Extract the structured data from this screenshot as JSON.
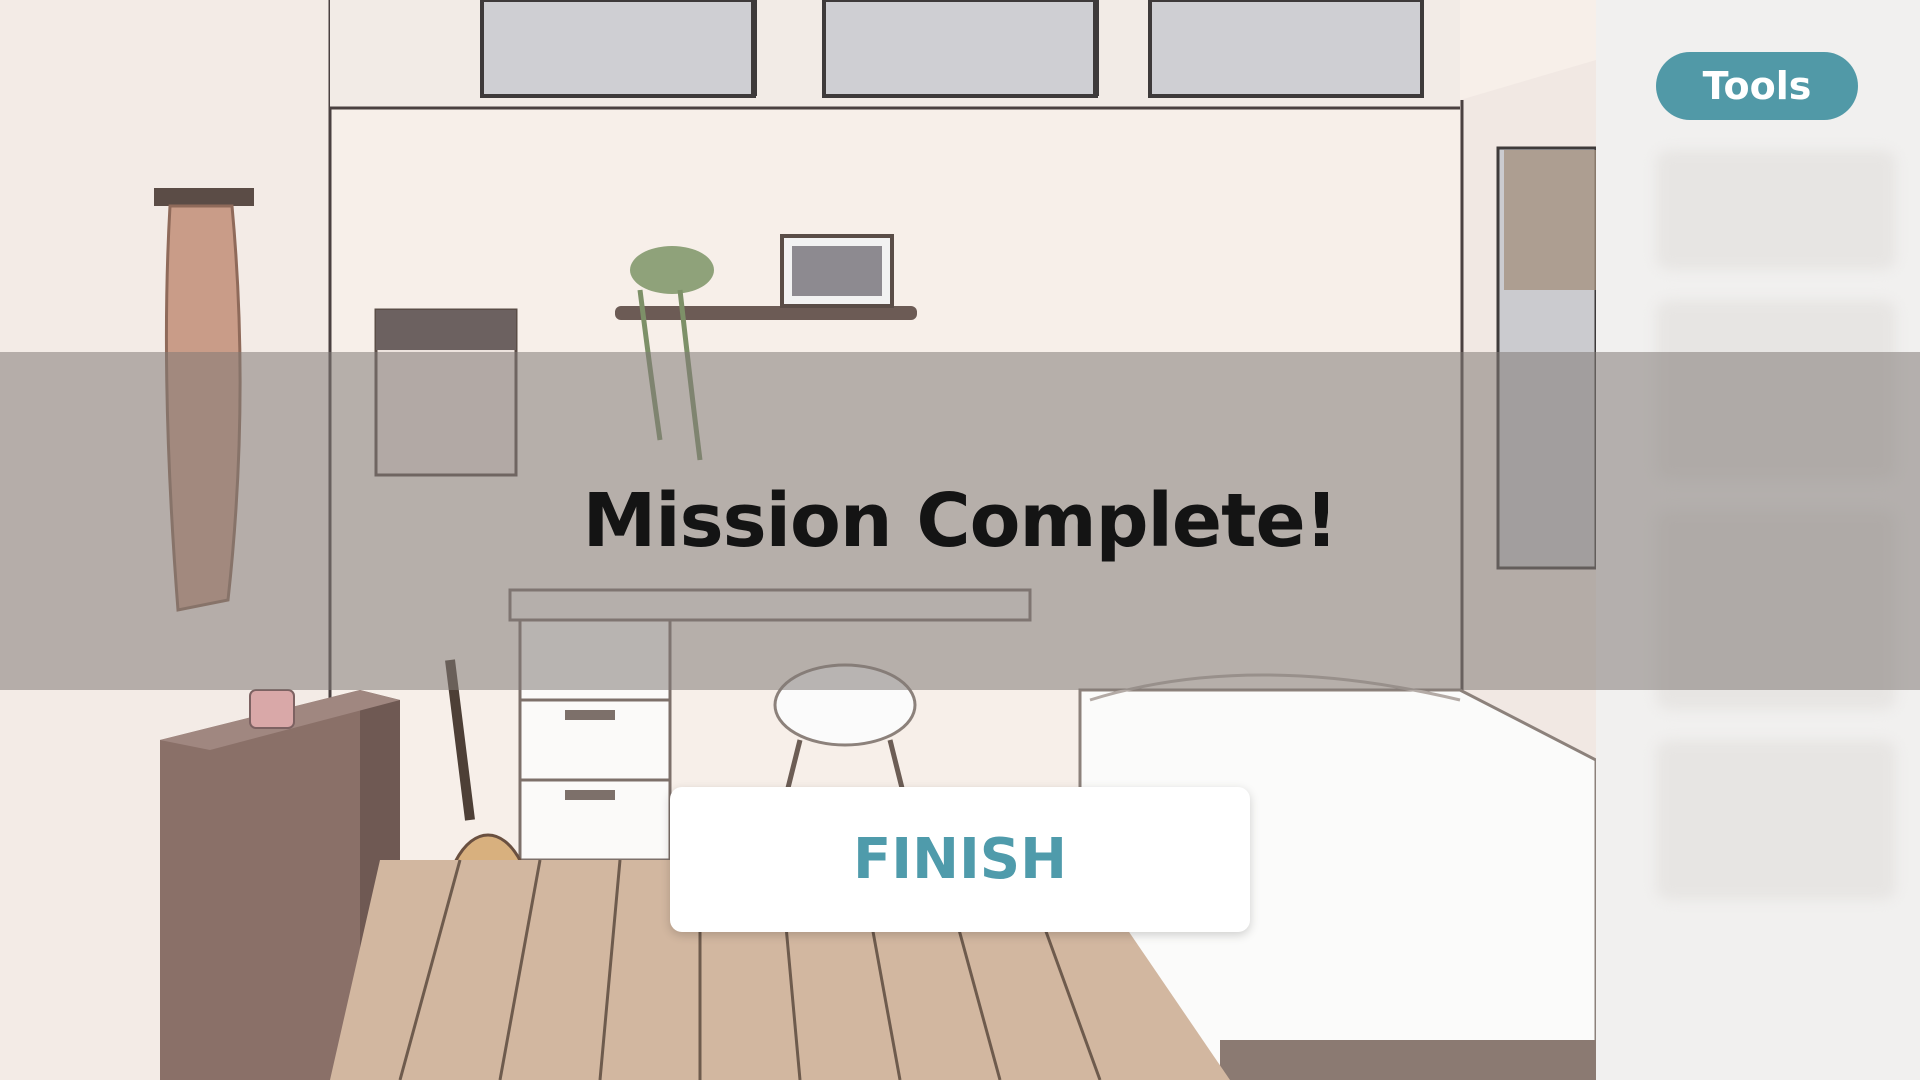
{
  "overlay": {
    "title": "Mission Complete!"
  },
  "buttons": {
    "finish_label": "FINISH",
    "tools_label": "Tools"
  },
  "colors": {
    "accent": "#5199a7",
    "finish_text": "#4f9bab",
    "title_text": "#141414",
    "overlay_band": "#827a76"
  }
}
